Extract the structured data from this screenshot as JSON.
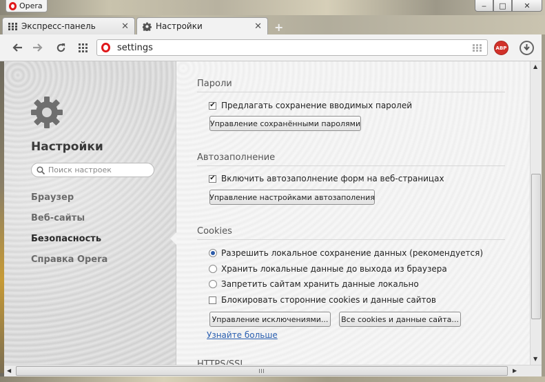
{
  "window": {
    "app_title": "Opera",
    "controls": {
      "minimize": "‒",
      "maximize": "□",
      "close": "✕"
    }
  },
  "tabs": [
    {
      "label": "Экспресс-панель",
      "icon": "grid-icon",
      "active": false
    },
    {
      "label": "Настройки",
      "icon": "gear-icon",
      "active": true
    }
  ],
  "toolbar": {
    "address": "settings",
    "extension_abp": "ABP",
    "icons": [
      "back-icon",
      "forward-icon",
      "reload-icon",
      "speed-dial-icon",
      "download-icon"
    ]
  },
  "sidebar": {
    "title": "Настройки",
    "search_placeholder": "Поиск настроек",
    "items": [
      {
        "label": "Браузер",
        "current": false
      },
      {
        "label": "Веб-сайты",
        "current": false
      },
      {
        "label": "Безопасность",
        "current": true
      },
      {
        "label": "Справка Opera",
        "current": false
      }
    ]
  },
  "sections": {
    "passwords": {
      "title": "Пароли",
      "offer_save": {
        "label": "Предлагать сохранение вводимых паролей",
        "checked": true
      },
      "manage_button": "Управление сохранёнными паролями"
    },
    "autofill": {
      "title": "Автозаполнение",
      "enable": {
        "label": "Включить автозаполнение форм на веб-страницах",
        "checked": true
      },
      "manage_button": "Управление настройками автозаполения"
    },
    "cookies": {
      "title": "Cookies",
      "radios": [
        {
          "label": "Разрешить локальное сохранение данных (рекомендуется)",
          "selected": true
        },
        {
          "label": "Хранить локальные данные до выхода из браузера",
          "selected": false
        },
        {
          "label": "Запретить сайтам хранить данные локально",
          "selected": false
        }
      ],
      "block_third_party": {
        "label": "Блокировать сторонние cookies и данные сайтов",
        "checked": false
      },
      "exceptions_button": "Управление исключениями...",
      "all_cookies_button": "Все cookies и данные сайта...",
      "learn_more": "Узнайте больше"
    },
    "https": {
      "title": "HTTPS/SSL"
    }
  },
  "colors": {
    "opera_red": "#e0181b",
    "link": "#2a5fb0",
    "abp_red": "#d1312a"
  }
}
